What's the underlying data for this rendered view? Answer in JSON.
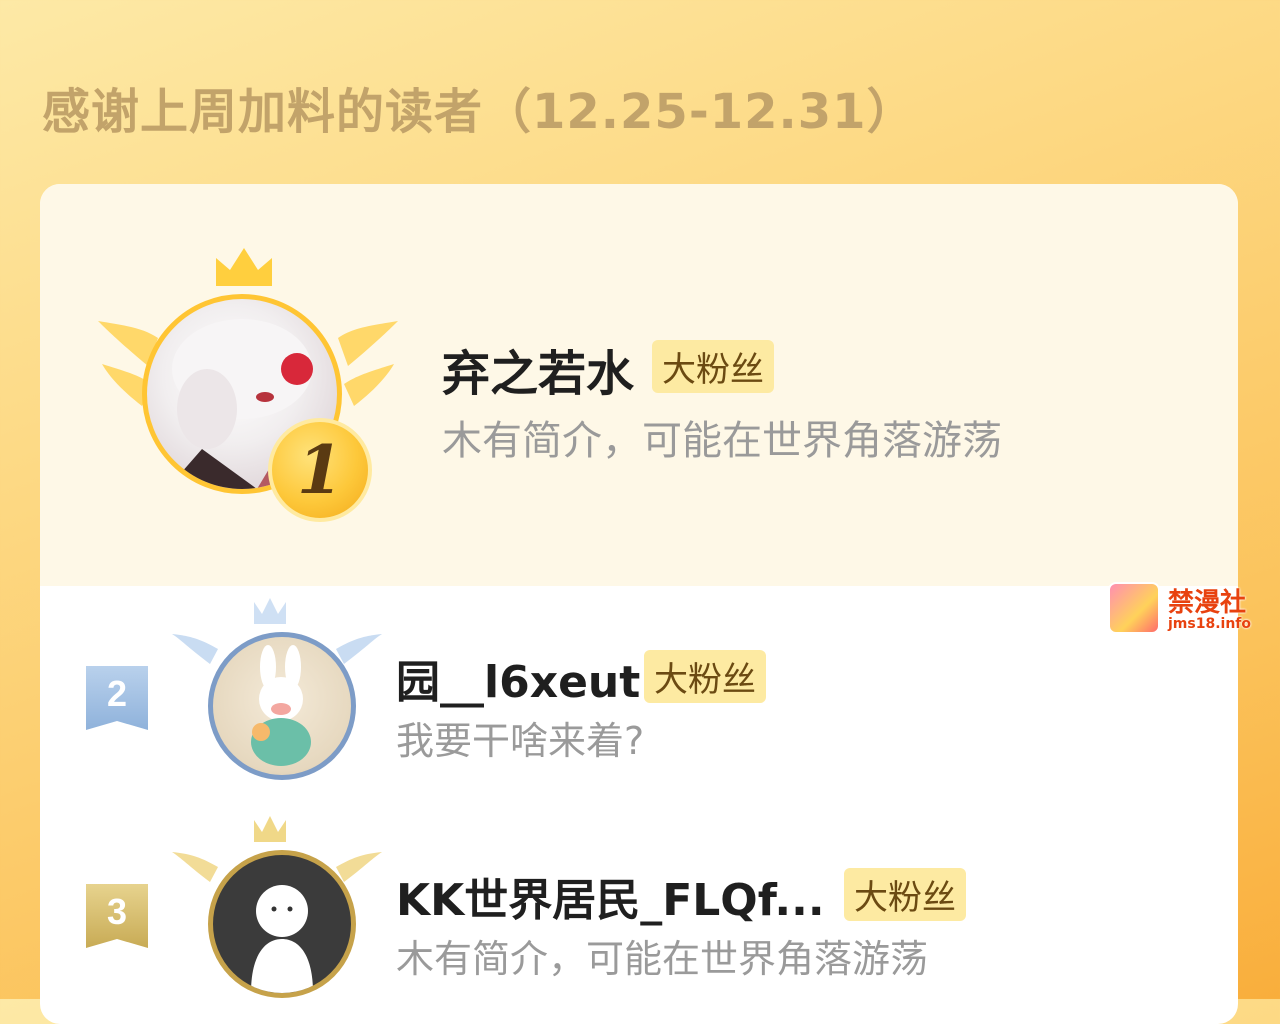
{
  "page_title": "感谢上周加料的读者（12.25-12.31）",
  "colors": {
    "accent_gold": "#fdc83a",
    "badge_bg": "#fdeaa2",
    "silver": "#8fb2db",
    "bronze": "#c8ab55"
  },
  "readers": [
    {
      "rank": "1",
      "name": "弃之若水",
      "badge": "大粉丝",
      "bio": "木有简介，可能在世界角落游荡",
      "avatar_icon": "anime-avatar"
    },
    {
      "rank": "2",
      "name": "园__l6xeut",
      "badge": "大粉丝",
      "bio": "我要干啥来着?",
      "avatar_icon": "rabbit-avatar"
    },
    {
      "rank": "3",
      "name": "KK世界居民_FLQf...",
      "badge": "大粉丝",
      "bio": "木有简介，可能在世界角落游荡",
      "avatar_icon": "default-avatar"
    }
  ],
  "watermark": {
    "title": "禁漫社",
    "url": "jms18.info"
  }
}
